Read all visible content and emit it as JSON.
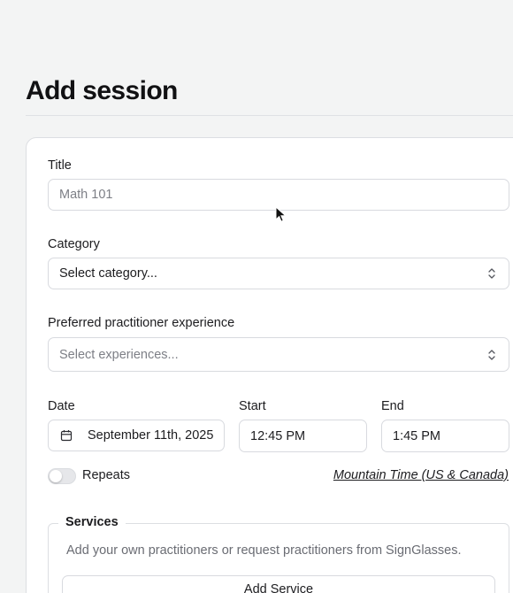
{
  "page": {
    "title": "Add session"
  },
  "form": {
    "title": {
      "label": "Title",
      "placeholder": "Math 101"
    },
    "category": {
      "label": "Category",
      "value": "Select category..."
    },
    "experience": {
      "label": "Preferred practitioner experience",
      "placeholder": "Select experiences..."
    },
    "date": {
      "label": "Date",
      "value": "September 11th, 2025",
      "icon": "calendar-icon"
    },
    "start": {
      "label": "Start",
      "value": "12:45 PM"
    },
    "end": {
      "label": "End",
      "value": "1:45 PM"
    },
    "repeats": {
      "label": "Repeats",
      "enabled": false
    },
    "timezone": "Mountain Time (US & Canada)"
  },
  "services": {
    "legend": "Services",
    "description": "Add your own practitioners or request practitioners from SignGlasses.",
    "add_button": "Add Service"
  },
  "colors": {
    "background": "#f3f4f4",
    "card": "#ffffff",
    "border": "#d8dadf",
    "placeholder": "#7d7f86",
    "text": "#1c1c1f"
  }
}
